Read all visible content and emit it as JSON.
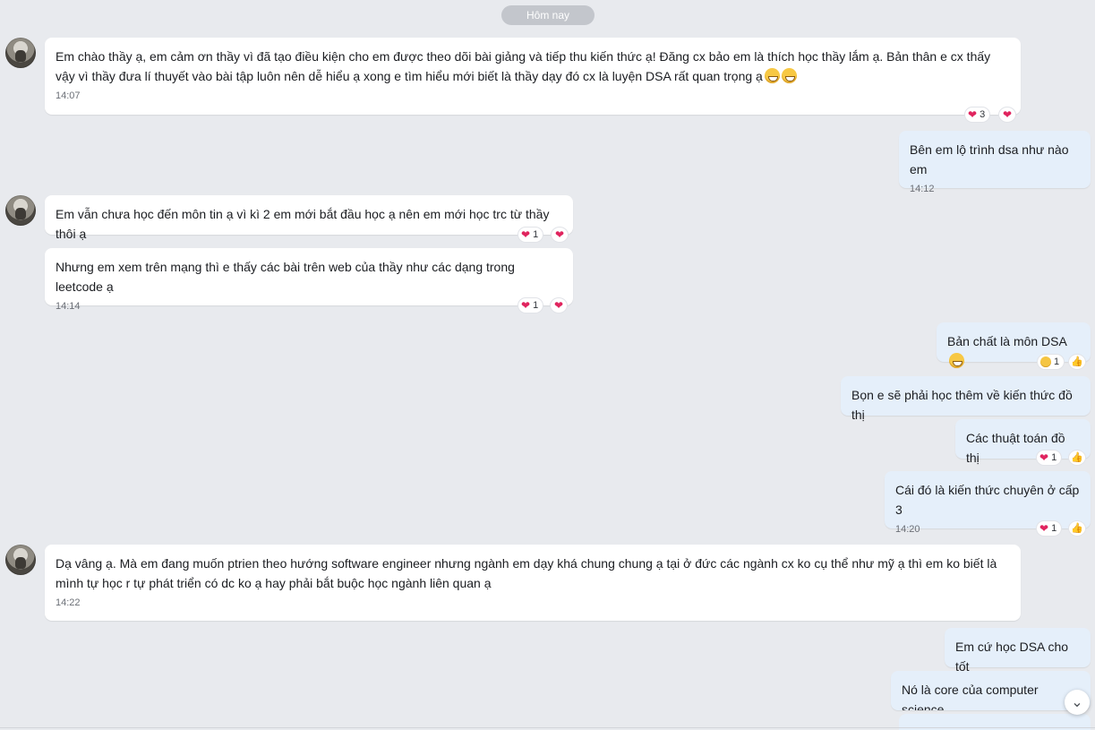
{
  "date_divider": "Hôm nay",
  "messages": [
    {
      "text": "Em chào thầy ạ, em cảm ơn thầy vì đã tạo điều kiện cho em được theo dõi bài giảng và tiếp thu kiến thức ạ! Đăng cx bảo em là thích học thầy lắm ạ. Bản thân e cx thấy vậy vì thầy đưa lí thuyết vào bài tập luôn nên dễ hiểu ạ xong e tìm hiểu mới biết là thầy dạy đó cx là luyện DSA rất quan trọng ạ",
      "time": "14:07",
      "reaction_count": "3"
    },
    {
      "text": "Bên em lộ trình dsa như nào em",
      "time": "14:12"
    },
    {
      "text": "Em vẫn chưa học đến môn tin ạ vì kì 2 em mới bắt đầu học ạ nên em mới học trc từ thầy thôi ạ",
      "reaction_count": "1"
    },
    {
      "text": "Nhưng em xem trên mạng thì e thấy các bài trên web của thầy như các dạng trong leetcode ạ",
      "time": "14:14",
      "reaction_count": "1"
    },
    {
      "text": "Bản chất là môn DSA",
      "reaction_count": "1"
    },
    {
      "text": "Bọn e sẽ phải học thêm về kiến thức đồ thị"
    },
    {
      "text": "Các thuật toán đồ thị",
      "reaction_count": "1"
    },
    {
      "text": "Cái đó là kiến thức chuyên ở cấp 3",
      "time": "14:20",
      "reaction_count": "1"
    },
    {
      "text": "Dạ vâng ạ. Mà em đang muốn ptrien theo hướng software engineer nhưng ngành em dạy khá chung chung ạ tại ở đức các ngành cx ko cụ thể như mỹ ạ thì em ko biết là mình tự học r tự phát triển có dc ko ạ hay phải bắt buộc học ngành liên quan ạ",
      "time": "14:22"
    },
    {
      "text": "Em cứ học DSA cho tốt"
    },
    {
      "text": "Nó là core của computer science"
    }
  ],
  "icons": {
    "heart": "❤",
    "like": "👍",
    "scroll_down": "⌄"
  },
  "colors": {
    "background": "#e8eaee",
    "incoming_bubble": "#ffffff",
    "outgoing_bubble": "#e5effa",
    "heart": "#e0245e"
  }
}
